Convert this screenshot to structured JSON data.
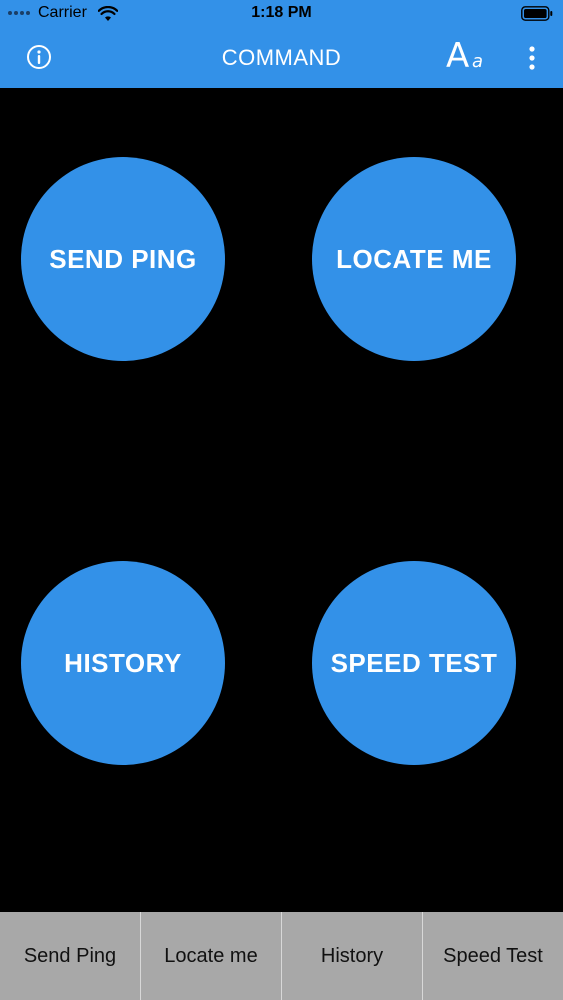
{
  "status_bar": {
    "carrier": "Carrier",
    "time": "1:18 PM"
  },
  "nav": {
    "title": "COMMAND",
    "info_icon": "info-icon",
    "font_icon": "font-size-icon",
    "font_big": "A",
    "font_small": "a",
    "more_icon": "more-vertical-icon"
  },
  "actions": [
    {
      "label": "SEND PING"
    },
    {
      "label": "LOCATE ME"
    },
    {
      "label": "HISTORY"
    },
    {
      "label": "SPEED TEST"
    }
  ],
  "tabs": [
    {
      "label": "Send Ping"
    },
    {
      "label": "Locate me"
    },
    {
      "label": "History"
    },
    {
      "label": "Speed Test"
    }
  ],
  "colors": {
    "accent": "#3391e8",
    "background": "#000000",
    "tabbar": "#a8a8a8"
  }
}
